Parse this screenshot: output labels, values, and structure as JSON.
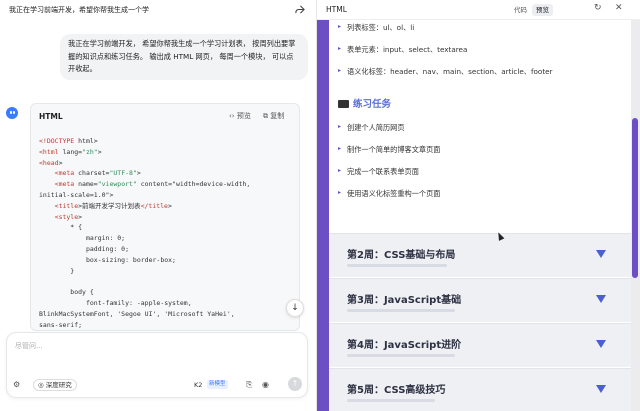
{
  "left": {
    "title": "我正在学习前端开发，希望你帮我生成一个学",
    "user_message": "我正在学习前端开发， 希望你帮我生成一个学习计划表， 按周列出要掌握的知识点和练习任务。 输出成 HTML 网页， 每周一个模块， 可以点开收起。",
    "code_block": {
      "lang": "HTML",
      "preview_label": "预览",
      "copy_label": "复制",
      "lines": [
        "<!DOCTYPE html>",
        "<html lang=\"zh\">",
        "<head>",
        "    <meta charset=\"UTF-8\">",
        "    <meta name=\"viewport\" content=\"width=device-width,",
        "initial-scale=1.0\">",
        "    <title>前端开发学习计划表</title>",
        "    <style>",
        "        * {",
        "            margin: 0;",
        "            padding: 0;",
        "            box-sizing: border-box;",
        "        }",
        "",
        "        body {",
        "            font-family: -apple-system,",
        "BlinkMacSystemFont, 'Segoe UI', 'Microsoft YaHei',",
        "sans-serif;"
      ]
    },
    "input": {
      "placeholder": "尽管问...",
      "deep_label": "深度研究",
      "model": "K2",
      "model_tag": "新模型"
    },
    "icons": {
      "share": "share-icon",
      "tools": "tools-icon",
      "attach": "attach-icon",
      "globe": "globe-icon",
      "send": "send-icon",
      "scroll": "arrow-down-icon"
    }
  },
  "right": {
    "title": "HTML",
    "tab_code": "代码",
    "tab_preview": "预览",
    "bullets_top": [
      "列表标签：ul、ol、li",
      "表单元素：input、select、textarea",
      "语义化标签：header、nav、main、section、article、footer"
    ],
    "task_title": "练习任务",
    "tasks": [
      "创建个人简历网页",
      "制作一个简单的博客文章页面",
      "完成一个联系表单页面",
      "使用语义化标签重构一个页面"
    ],
    "weeks": [
      "第2周：CSS基础与布局",
      "第3周：JavaScript基础",
      "第4周：JavaScript进阶",
      "第5周：CSS高级技巧"
    ],
    "colors": {
      "accent": "#6b4fc3",
      "task_title": "#5a6fd6",
      "triangle": "#4a5fd0"
    }
  }
}
